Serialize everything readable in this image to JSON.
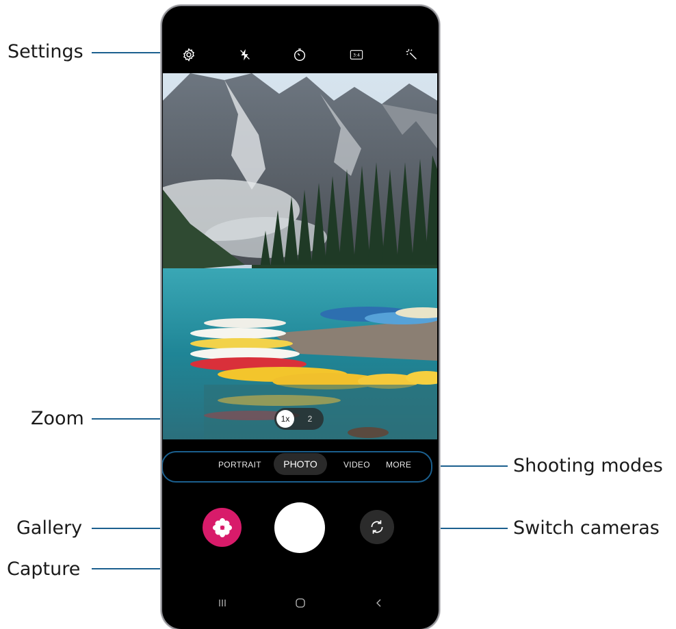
{
  "callouts": {
    "settings": "Settings",
    "zoom": "Zoom",
    "shooting_modes": "Shooting modes",
    "gallery": "Gallery",
    "switch_cameras": "Switch cameras",
    "capture": "Capture"
  },
  "topbar": {
    "icons": [
      "gear-icon",
      "flash-off-icon",
      "timer-icon",
      "aspect-ratio-icon",
      "filters-icon"
    ],
    "aspect_ratio_label": "3:4"
  },
  "zoom": {
    "selected": "1x",
    "other": "2"
  },
  "modes": {
    "items": [
      "PORTRAIT",
      "PHOTO",
      "VIDEO",
      "MORE"
    ],
    "selected": "PHOTO"
  },
  "controls": {
    "gallery_icon": "flower-icon",
    "switch_icon": "switch-camera-icon"
  },
  "navbar": {
    "icons": [
      "recents-icon",
      "home-icon",
      "back-icon"
    ]
  },
  "colors": {
    "leader": "#1b5f8e",
    "gallery": "#d81b6a",
    "phone_bg": "#000000"
  }
}
